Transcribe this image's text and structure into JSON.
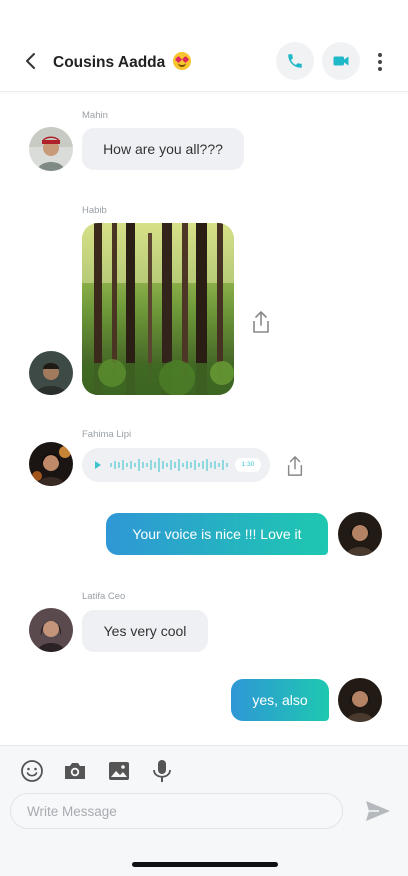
{
  "header": {
    "title": "Cousins Aadda",
    "title_emoji": "heart-eyes-emoji",
    "back_icon": "chevron-left-icon",
    "call_icon": "phone-icon",
    "video_icon": "video-camera-icon",
    "more_icon": "more-vertical-icon",
    "accent": "#1fb8c8"
  },
  "messages": [
    {
      "sender": "Mahin",
      "type": "text",
      "direction": "incoming",
      "text": "How are you all???"
    },
    {
      "sender": "Habib",
      "type": "image",
      "direction": "incoming",
      "image": "forest-photo"
    },
    {
      "sender": "Fahima Lipi",
      "type": "audio",
      "direction": "incoming",
      "duration": "1:30"
    },
    {
      "sender": "",
      "type": "text",
      "direction": "outgoing",
      "text": "Your voice is nice !!! Love it"
    },
    {
      "sender": "Latifa Ceo",
      "type": "text",
      "direction": "incoming",
      "text": "Yes very cool"
    },
    {
      "sender": "",
      "type": "text",
      "direction": "outgoing",
      "text": "yes, also"
    }
  ],
  "composer": {
    "tools": [
      "emoji-icon",
      "camera-icon",
      "gallery-icon",
      "microphone-icon"
    ],
    "placeholder": "Write Message",
    "value": "",
    "send_icon": "send-icon"
  },
  "colors": {
    "gradient_start": "#2f97d6",
    "gradient_end": "#1ec8b0",
    "incoming_bubble": "#eef0f3"
  }
}
